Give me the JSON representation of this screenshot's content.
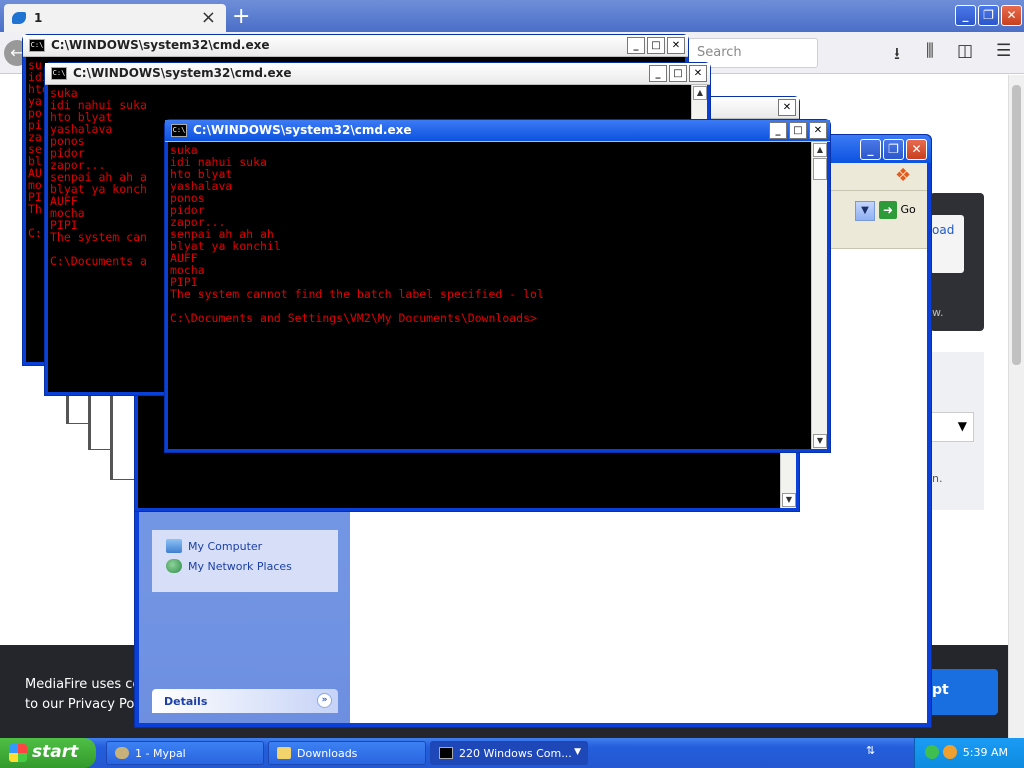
{
  "browser": {
    "tab_label": "1",
    "search_placeholder": "Search",
    "page_link_fragment": "oad",
    "page_text_fragment": "w.",
    "page_text_fragment2": "n.",
    "cookie_text_line1": "MediaFire uses coo",
    "cookie_text_line2": "to our Privacy Polic",
    "cookie_button_fragment": "pt"
  },
  "explorer": {
    "go_label": "Go",
    "tasks": [
      {
        "label": "My Computer",
        "icon": "my-computer-icon"
      },
      {
        "label": "My Network Places",
        "icon": "network-places-icon"
      }
    ],
    "details_label": "Details"
  },
  "cmd_windows": {
    "title": "C:\\WINDOWS\\system32\\cmd.exe",
    "back_lines": [
      "su",
      "idi",
      "hto",
      "ya",
      "po",
      "pi",
      "za",
      "se",
      "bl",
      "AU",
      "mo",
      "PI",
      "Th",
      "",
      "C:"
    ],
    "mid_lines": [
      "suka",
      "idi nahui suka",
      "hto blyat",
      "yashalava",
      "ponos",
      "pidor",
      "zapor...",
      "senpai ah ah a",
      "blyat ya konch",
      "AUFF",
      "mocha",
      "PIPI",
      "The system can",
      "",
      "C:\\Documents a"
    ],
    "front_lines": [
      "suka",
      "idi nahui suka",
      "hto blyat",
      "yashalava",
      "ponos",
      "pidor",
      "zapor...",
      "senpai ah ah ah",
      "blyat ya konchil",
      "AUFF",
      "mocha",
      "PIPI",
      "The system cannot find the batch label specified - lol",
      "",
      "C:\\Documents and Settings\\VM2\\My Documents\\Downloads>"
    ]
  },
  "taskbar": {
    "start_label": "start",
    "buttons": [
      {
        "label": "1 - Mypal",
        "icon": "mypal-icon"
      },
      {
        "label": "Downloads",
        "icon": "folder-icon"
      },
      {
        "label": "220 Windows Com...",
        "icon": "cmd-icon"
      }
    ],
    "clock": "5:39 AM"
  },
  "colors": {
    "console_text": "#e10000",
    "xp_blue": "#0a3fd8",
    "start_green": "#339a2c"
  }
}
